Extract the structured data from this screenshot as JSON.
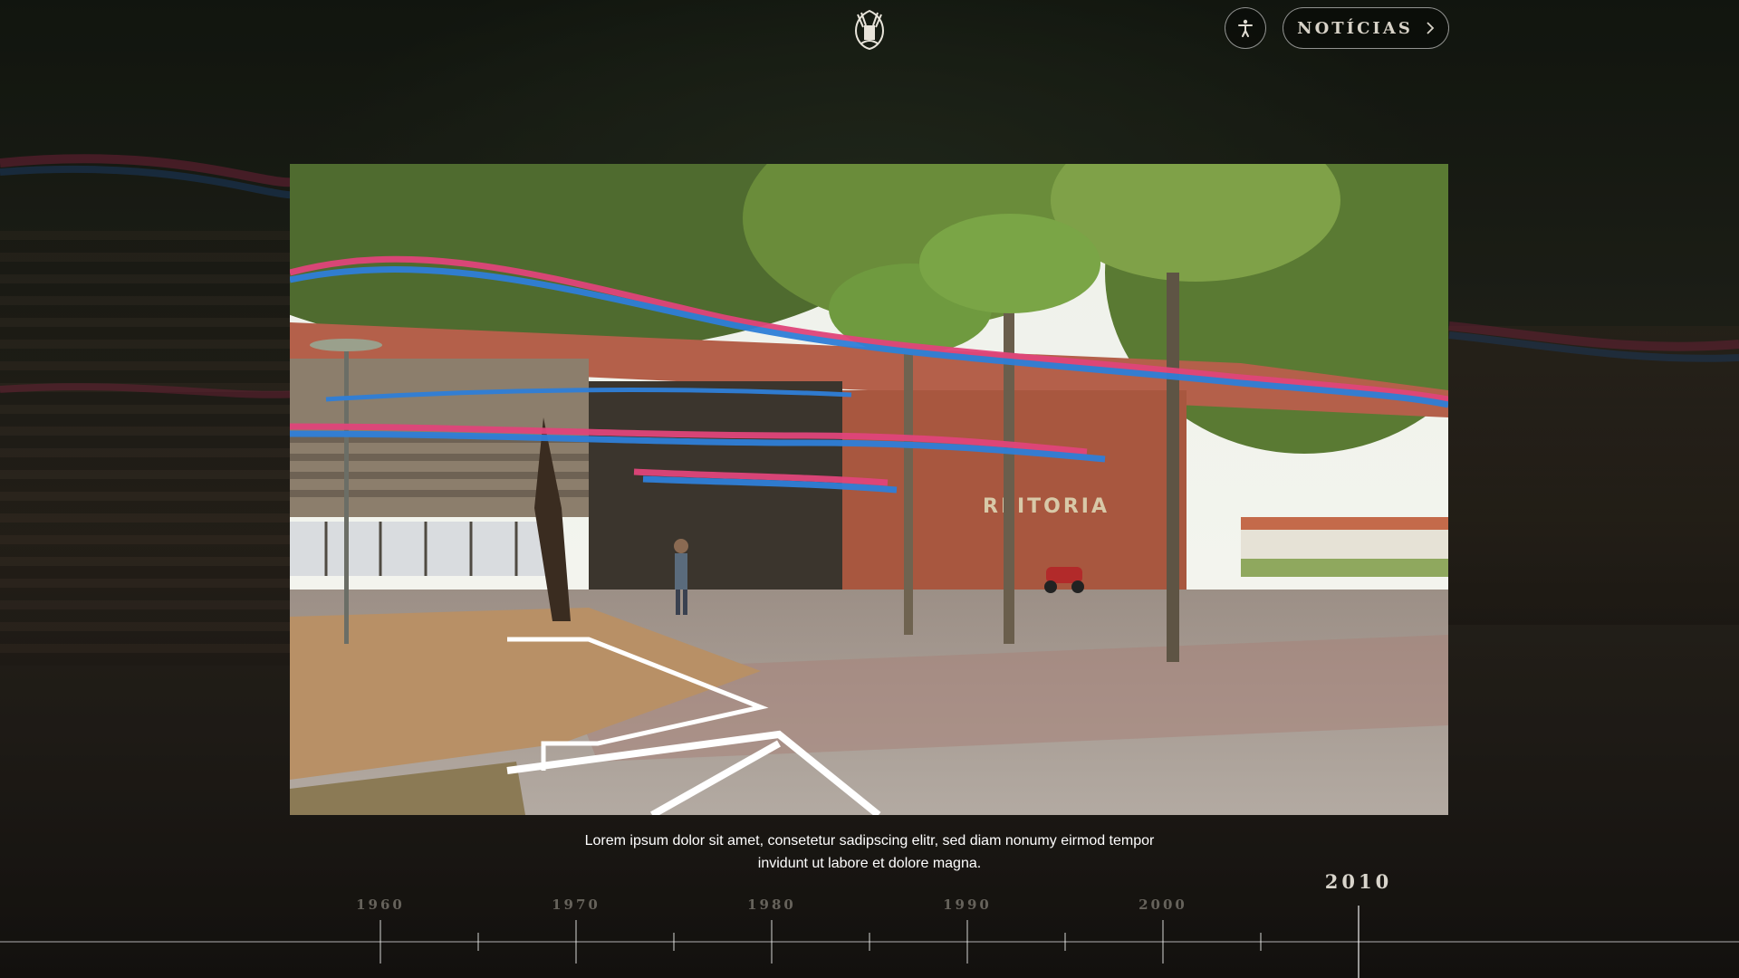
{
  "header": {
    "logo_icon": "university-seal-icon",
    "accessibility_icon": "accessibility-person-icon",
    "news_label": "NOTÍCIAS",
    "news_icon": "chevron-right-icon"
  },
  "photo": {
    "sign_text": "REITORIA",
    "caption": "Lorem ipsum dolor sit amet, consetetur sadipscing elitr, sed diam nonumy eirmod tempor invidunt ut labore et dolore magna."
  },
  "timeline": {
    "years": [
      "1960",
      "1970",
      "1980",
      "1990",
      "2000",
      "2010"
    ],
    "active_year": "2010"
  },
  "colors": {
    "ribbon_pink": "#e0457a",
    "ribbon_blue": "#2f7fd8",
    "text_light": "#d9d5cc"
  }
}
